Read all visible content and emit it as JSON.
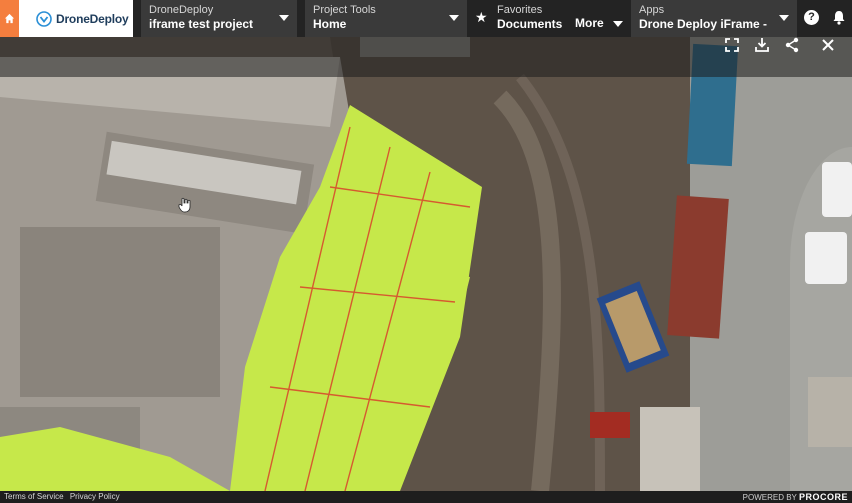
{
  "brand": {
    "name": "DroneDeploy"
  },
  "nav": {
    "dronedeploy": {
      "label": "DroneDeploy",
      "value": "iframe test project"
    },
    "project_tools": {
      "label": "Project Tools",
      "value": "Home"
    },
    "favorites": {
      "label": "Favorites",
      "value": "Documents",
      "more": "More"
    },
    "apps": {
      "label": "Apps",
      "value": "Drone Deploy iFrame - Ev..."
    },
    "help_icon": "?",
    "icons": [
      "home-icon",
      "dronedeploy-logo-icon",
      "chevron-down-icon",
      "star-icon",
      "help-icon",
      "bell-icon"
    ]
  },
  "map": {
    "toolbar_icons": [
      "fullscreen-icon",
      "download-icon",
      "share-icon",
      "close-icon"
    ],
    "cursor_icon": "hand-pointer-icon"
  },
  "footer": {
    "terms": "Terms of Service",
    "privacy": "Privacy Policy",
    "powered_by": "POWERED BY",
    "procore": "PROCORE"
  },
  "colors": {
    "home": "#f47e3e",
    "nav_bg": "#232323",
    "dropdown_bg": "#3a3a3a",
    "slab": "#c6e84a"
  }
}
